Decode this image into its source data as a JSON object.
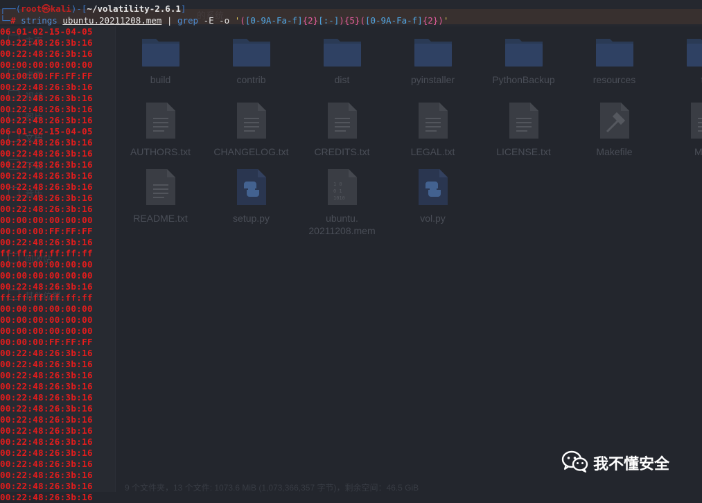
{
  "file_manager": {
    "header_text": "的系统",
    "sidebar_labels": [
      "主页",
      "桌面",
      "视频",
      "图片",
      "文档",
      "下载",
      "音乐",
      "回收站",
      "其他位置"
    ],
    "items": [
      {
        "name": "build",
        "type": "folder"
      },
      {
        "name": "contrib",
        "type": "folder"
      },
      {
        "name": "dist",
        "type": "folder"
      },
      {
        "name": "pyinstaller",
        "type": "folder"
      },
      {
        "name": "PythonBackup",
        "type": "folder"
      },
      {
        "name": "resources",
        "type": "folder"
      },
      {
        "name": "to",
        "type": "folder"
      },
      {
        "name": "AUTHORS.txt",
        "type": "text"
      },
      {
        "name": "CHANGELOG.txt",
        "type": "text"
      },
      {
        "name": "CREDITS.txt",
        "type": "text"
      },
      {
        "name": "LEGAL.txt",
        "type": "text"
      },
      {
        "name": "LICENSE.txt",
        "type": "text"
      },
      {
        "name": "Makefile",
        "type": "make"
      },
      {
        "name": "MAN",
        "type": "text"
      },
      {
        "name": "README.txt",
        "type": "text"
      },
      {
        "name": "setup.py",
        "type": "python"
      },
      {
        "name": "ubuntu.\n20211208.mem",
        "type": "binary"
      },
      {
        "name": "vol.py",
        "type": "python"
      }
    ],
    "status": "9 个文件夹，13 个文件: 1073.6 MiB (1,073,366,357 字节)，剩余空间：46.5 GiB"
  },
  "terminal": {
    "user": "root",
    "at": "㉿",
    "host": "kali",
    "cwd": "~/volatility-2.6.1",
    "prompt_symbol": "#",
    "command": "strings",
    "file_arg": "ubuntu.20211208.mem",
    "pipe": "|",
    "grep_cmd": "grep",
    "grep_flags": "-E -o",
    "pattern_parts": [
      "'",
      "(",
      "[0-9A-Fa-f]",
      "{2}",
      "[:-]",
      ")",
      "{5}",
      "(",
      "[0-9A-Fa-f]",
      "{2}",
      ")",
      "'"
    ],
    "output_lines": [
      "06-01-02-15-04-05",
      "00:22:48:26:3b:16",
      "00:22:48:26:3b:16",
      "00:00:00:00:00:00",
      "00:00:00:FF:FF:FF",
      "00:22:48:26:3b:16",
      "00:22:48:26:3b:16",
      "00:22:48:26:3b:16",
      "00:22:48:26:3b:16",
      "06-01-02-15-04-05",
      "00:22:48:26:3b:16",
      "00:22:48:26:3b:16",
      "00:22:48:26:3b:16",
      "00:22:48:26:3b:16",
      "00:22:48:26:3b:16",
      "00:22:48:26:3b:16",
      "00:22:48:26:3b:16",
      "00:00:00:00:00:00",
      "00:00:00:FF:FF:FF",
      "00:22:48:26:3b:16",
      "ff:ff:ff:ff:ff:ff",
      "00:00:00:00:00:00",
      "00:00:00:00:00:00",
      "00:22:48:26:3b:16",
      "ff:ff:ff:ff:ff:ff",
      "00:00:00:00:00:00",
      "00:00:00:00:00:00",
      "00:00:00:00:00:00",
      "00:00:00:FF:FF:FF",
      "00:22:48:26:3b:16",
      "00:22:48:26:3b:16",
      "00:22:48:26:3b:16",
      "00:22:48:26:3b:16",
      "00:22:48:26:3b:16",
      "00:22:48:26:3b:16",
      "00:22:48:26:3b:16",
      "00:22:48:26:3b:16",
      "00:22:48:26:3b:16",
      "00:22:48:26:3b:16",
      "00:22:48:26:3b:16",
      "00:22:48:26:3b:16",
      "00:22:48:26:3b:16",
      "00:22:48:26:3b:16"
    ]
  },
  "watermark": {
    "text": "我不懂安全",
    "icon": "wechat-icon"
  }
}
